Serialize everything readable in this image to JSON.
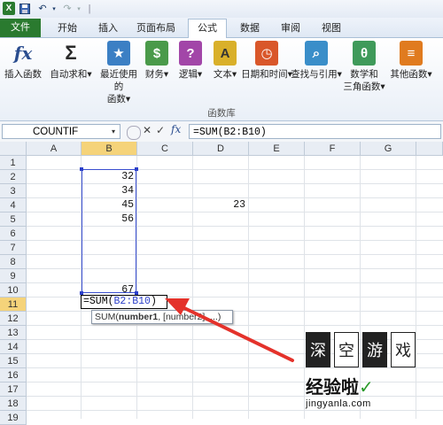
{
  "quick_access": {
    "app_icon": "excel-icon",
    "save_icon": "save-icon",
    "undo_icon": "undo-icon",
    "redo_icon": "redo-icon",
    "separator": "|"
  },
  "tabs": [
    "文件",
    "开始",
    "插入",
    "页面布局",
    "公式",
    "数据",
    "审阅",
    "视图"
  ],
  "active_tab": "公式",
  "ribbon": {
    "buttons": [
      {
        "icon": "fx",
        "label": "插入函数",
        "icon_name": "insert-function-icon",
        "color": "#2a4d8f"
      },
      {
        "icon": "Σ",
        "label": "自动求和▾",
        "icon_name": "autosum-icon",
        "color": "#2a2a2a"
      },
      {
        "icon": "★",
        "label": "最近使用的\n函数▾",
        "icon_name": "recent-functions-icon",
        "color": "#3b7fc4"
      },
      {
        "icon": "$",
        "label": "财务▾",
        "icon_name": "financial-icon",
        "color": "#4a9a4a"
      },
      {
        "icon": "?",
        "label": "逻辑▾",
        "icon_name": "logical-icon",
        "color": "#a246a8"
      },
      {
        "icon": "A",
        "label": "文本▾",
        "icon_name": "text-icon",
        "color": "#d9b02a"
      },
      {
        "icon": "◷",
        "label": "日期和时间▾",
        "icon_name": "date-time-icon",
        "color": "#d9572a"
      },
      {
        "icon": "⌕",
        "label": "查找与引用▾",
        "icon_name": "lookup-reference-icon",
        "color": "#3a8ec9"
      },
      {
        "icon": "θ",
        "label": "数学和\n三角函数▾",
        "icon_name": "math-trig-icon",
        "color": "#3f9a5a"
      },
      {
        "icon": "≡",
        "label": "其他函数▾",
        "icon_name": "more-functions-icon",
        "color": "#e07b1f"
      }
    ],
    "group_label": "函数库"
  },
  "formula_bar": {
    "name_box": "COUNTIF",
    "cancel": "✕",
    "enter": "✓",
    "fx": "fx",
    "formula": "=SUM(B2:B10)"
  },
  "columns": [
    "A",
    "B",
    "C",
    "D",
    "E",
    "F",
    "G"
  ],
  "selected_column": "B",
  "rows": [
    "1",
    "2",
    "3",
    "4",
    "5",
    "6",
    "7",
    "8",
    "9",
    "10",
    "11",
    "12",
    "13",
    "14",
    "15",
    "16",
    "17",
    "18",
    "19"
  ],
  "selected_row": "11",
  "cells": {
    "B2": "32",
    "B3": "34",
    "B4": "45",
    "B5": "56",
    "B10": "67",
    "D4": "23"
  },
  "editing_cell": {
    "prefix": "=SUM(",
    "ref": "B2:B10",
    "suffix": ")"
  },
  "tooltip": {
    "func": "SUM(",
    "arg1": "number1",
    "rest": ", [number2], ...)"
  },
  "watermark": {
    "seal_chars": [
      "深",
      "空",
      "游",
      "戏"
    ],
    "site": "经验啦",
    "check": "✓",
    "domain": "jingyanla.com"
  }
}
